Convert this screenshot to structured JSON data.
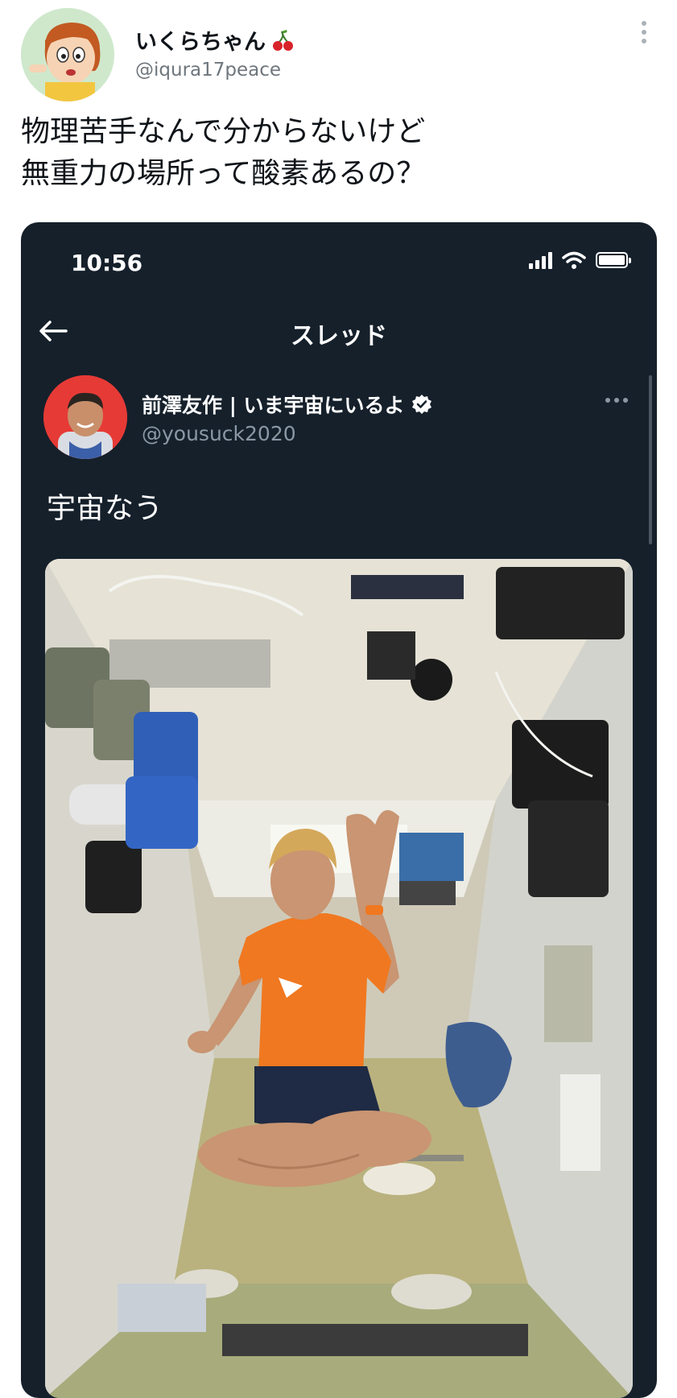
{
  "outer_tweet": {
    "display_name": "いくらちゃん",
    "name_emoji": "cherry-icon",
    "handle": "@iqura17peace",
    "text_line1": "物理苦手なんで分からないけど",
    "text_line2": "無重力の場所って酸素あるの？"
  },
  "screenshot": {
    "status_time": "10:56",
    "status_icons": [
      "signal-icon",
      "wifi-icon",
      "battery-icon"
    ],
    "nav_title": "スレッド",
    "tweet": {
      "display_name": "前澤友作 | いま宇宙にいるよ",
      "handle": "@yousuck2020",
      "text": "宇宙なう",
      "verified": true
    }
  },
  "colors": {
    "screenshot_bg": "#15202b",
    "shirt": "#f07820",
    "avatar_bg": "#e63a36"
  }
}
